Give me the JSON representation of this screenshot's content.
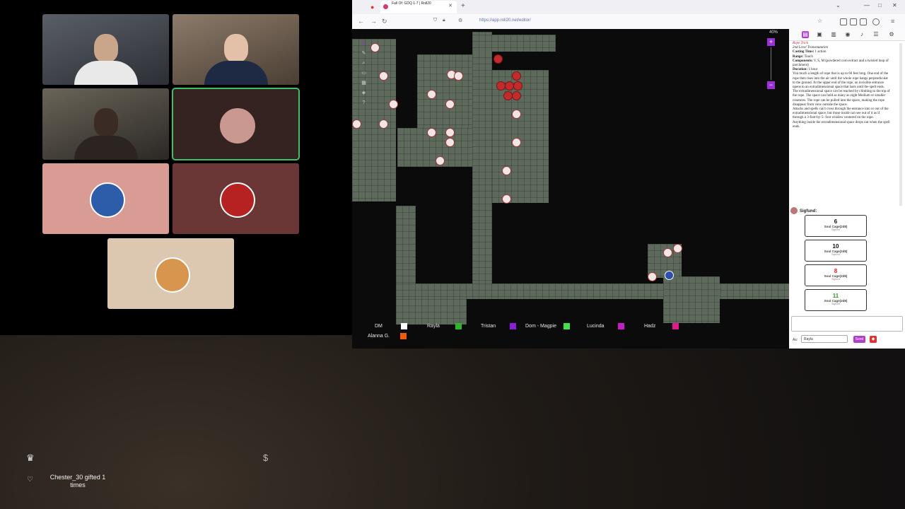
{
  "browser": {
    "tab_title": "Fall Of: GDQ 1-7 | Roll20",
    "tab_subtitle": "",
    "url": "https://app.roll20.net/editor/"
  },
  "vtt": {
    "zoom_level": "40%",
    "players": [
      {
        "name": "DM",
        "color": "#ffffff"
      },
      {
        "name": "Rayla",
        "color": "#2fb52a"
      },
      {
        "name": "Tristan",
        "color": "#8a1fd6"
      },
      {
        "name": "Dom - Magpie",
        "color": "#44e04a"
      },
      {
        "name": "Lucinda",
        "color": "#c21ec8"
      },
      {
        "name": "Hadz",
        "color": "#e01a8c"
      },
      {
        "name": "Alanna G.",
        "color": "#ee5a0e"
      }
    ]
  },
  "spell": {
    "title": "Rope Trick",
    "school": "2nd Level Transmutation",
    "casting_time_label": "Casting Time:",
    "casting_time": "1 action",
    "range_label": "Range:",
    "range": "Touch",
    "components_label": "Components:",
    "components": "V, S, M (powdered corn extract and a twisted loop of parchment)",
    "duration_label": "Duration:",
    "duration": "1 hour",
    "p1": "You touch a length of rope that is up to 60 feet long. One end of the rope then rises into the air until the whole rope hangs perpendicular to the ground. At the upper end of the rope, an invisible entrance opens to an extradimensional space that lasts until the spell ends.",
    "p2": "The extradimensional space can be reached by climbing to the top of the rope. The space can hold as many as eight Medium or smaller creatures. The rope can be pulled into the space, making the rope disappear from view outside the space.",
    "p3": "Attacks and spells can't cross through the entrance into or out of the extradimensional space, but those inside can see out of it as if through a 3-foot-by-5- foot window centered on the rope.",
    "p4": "Anything inside the extradimensional space drops out when the spell ends."
  },
  "chat": {
    "speaker": "Sigfund:",
    "rolls": [
      {
        "value": "6",
        "label": "Soul Cage(2d8)",
        "sub": "Sigfund",
        "color": "#111111"
      },
      {
        "value": "10",
        "label": "Soul Cage(2d8)",
        "sub": "Sigfund",
        "color": "#111111"
      },
      {
        "value": "8",
        "label": "Soul Cage(2d8)",
        "sub": "Sigfund",
        "color": "#d22222"
      },
      {
        "value": "11",
        "label": "Soul Cage(2d8)",
        "sub": "Sigfund",
        "color": "#2aa12a"
      }
    ],
    "as_label": "As:",
    "as_value": "Rayla",
    "send_label": "Send"
  },
  "overlay": {
    "alert_text": "Chester_30 gifted 1 times"
  }
}
